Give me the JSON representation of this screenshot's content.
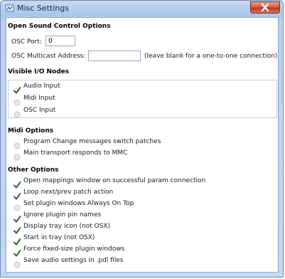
{
  "window": {
    "title": "Misc Settings"
  },
  "osc": {
    "heading": "Open Sound Control Options",
    "port_label": "OSC Port:",
    "port_value": "0",
    "multicast_label": "OSC Multicast Address:",
    "multicast_value": "",
    "multicast_hint": "(leave blank for a one-to-one connection)"
  },
  "io_nodes": {
    "heading": "Visible I/O Nodes",
    "items": [
      {
        "label": "Audio Input",
        "checked": true
      },
      {
        "label": "Midi Input",
        "checked": false
      },
      {
        "label": "OSC Input",
        "checked": false
      }
    ]
  },
  "midi": {
    "heading": "Midi Options",
    "items": [
      {
        "label": "Program Change messages switch patches",
        "checked": false
      },
      {
        "label": "Main transport responds to MMC",
        "checked": false
      }
    ]
  },
  "other": {
    "heading": "Other Options",
    "items": [
      {
        "label": "Open mappings window on successful param connection",
        "checked": true
      },
      {
        "label": "Loop next/prev patch action",
        "checked": true
      },
      {
        "label": "Set plugin windows Always On Top",
        "checked": false
      },
      {
        "label": "Ignore plugin pin names",
        "checked": true
      },
      {
        "label": "Display tray icon (not OSX)",
        "checked": true
      },
      {
        "label": "Start in tray (not OSX)",
        "checked": true
      },
      {
        "label": "Force fixed-size plugin windows",
        "checked": true
      },
      {
        "label": "Save audio settings in .pdl files",
        "checked": false
      }
    ]
  },
  "icons": {
    "app": "app-icon",
    "close": "close-icon",
    "checked": "checkmark-icon",
    "unchecked": "unchecked-circle-icon"
  },
  "colors": {
    "check": "#2b6b2b",
    "unchecked_fill": "#e6e6e6",
    "close_button": "#c9432a"
  }
}
